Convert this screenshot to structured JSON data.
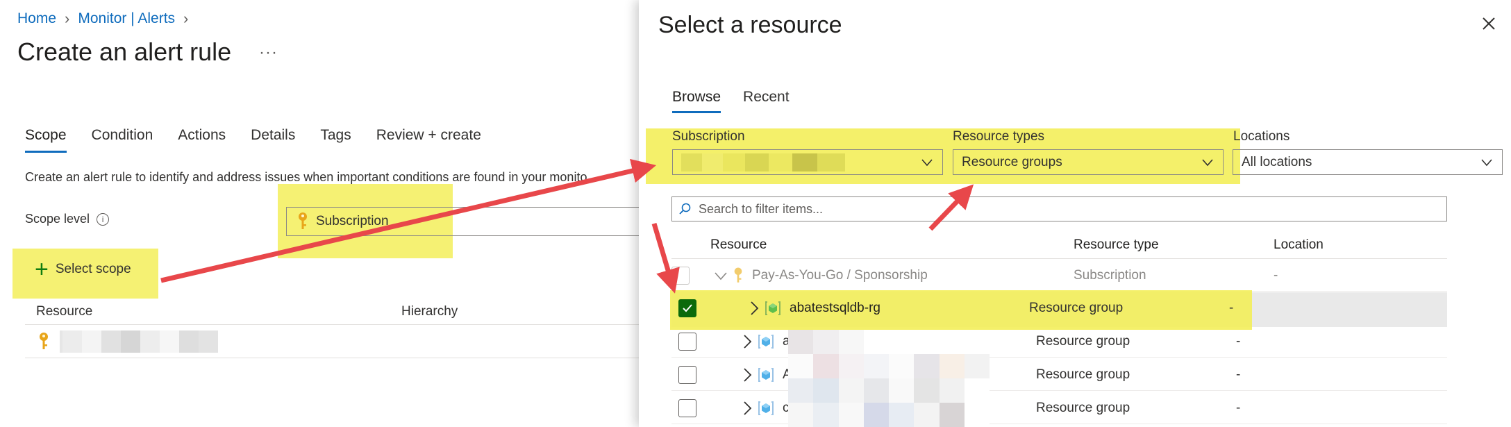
{
  "breadcrumb": {
    "home": "Home",
    "section": "Monitor | Alerts"
  },
  "page": {
    "title": "Create an alert rule",
    "more": "···"
  },
  "left_tabs": [
    "Scope",
    "Condition",
    "Actions",
    "Details",
    "Tags",
    "Review + create"
  ],
  "description": "Create an alert rule to identify and address issues when important conditions are found in your monito",
  "scope": {
    "level_label": "Scope level",
    "level_value": "Subscription",
    "select_label": "Select scope"
  },
  "left_table": {
    "headers": [
      "Resource",
      "Hierarchy"
    ]
  },
  "blade": {
    "title": "Select a resource",
    "tabs": [
      "Browse",
      "Recent"
    ],
    "filters": {
      "subscription_label": "Subscription",
      "resource_types_label": "Resource types",
      "resource_types_value": "Resource groups",
      "locations_label": "Locations",
      "locations_value": "All locations"
    },
    "search_placeholder": "Search to filter items...",
    "grid": {
      "headers": [
        "Resource",
        "Resource type",
        "Location"
      ],
      "rows": [
        {
          "name": "Pay-As-You-Go / Sponsorship",
          "type": "Subscription",
          "location": "-"
        },
        {
          "name": "abatestsqldb-rg",
          "type": "Resource group",
          "location": "-"
        },
        {
          "name": "a",
          "type": "Resource group",
          "location": "-"
        },
        {
          "name": "A",
          "type": "Resource group",
          "location": "-"
        },
        {
          "name": "c",
          "type": "Resource group",
          "location": "-"
        }
      ]
    }
  },
  "colors": {
    "accent": "#0f6cbd",
    "highlight": "#f3ee5a",
    "arrow": "#e8474a",
    "checked": "#0b6a0b"
  }
}
